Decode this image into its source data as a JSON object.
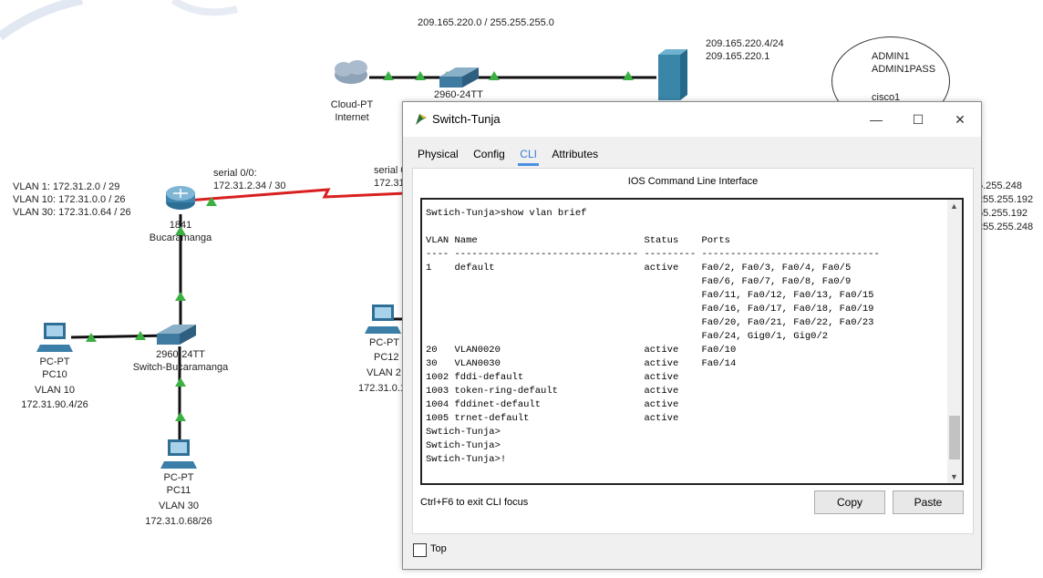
{
  "topology": {
    "network_top": "209.165.220.0 / 255.255.255.0",
    "server_ip": "209.165.220.4/24",
    "server_gw": "209.165.220.1",
    "oval_texts": [
      "ADMIN1",
      "ADMIN1PASS",
      "cisco1"
    ],
    "cloud": {
      "type": "Cloud-PT",
      "name": "Internet"
    },
    "switch_top": "2960-24TT",
    "vlan_list": [
      "VLAN 1: 172.31.2.0 / 29",
      "VLAN 10: 172.31.0.0 / 26",
      "VLAN 30: 172.31.0.64 / 26"
    ],
    "serial_left": {
      "title": "serial 0/0:",
      "ip": "172.31.2.34 / 30"
    },
    "serial_right": {
      "title": "serial 0",
      "ip": "172.31"
    },
    "router": {
      "model": "1841",
      "name": "Bucaramanga"
    },
    "switch_buc": {
      "model": "2960-24TT",
      "name": "Switch-Bucaramanga"
    },
    "pc10": {
      "type": "PC-PT",
      "name": "PC10",
      "vlan": "VLAN 10",
      "ip": "172.31.90.4/26"
    },
    "pc11": {
      "type": "PC-PT",
      "name": "PC11",
      "vlan": "VLAN 30",
      "ip": "172.31.0.68/26"
    },
    "pc12": {
      "type": "PC-PT",
      "name": "PC12",
      "vlan": "VLAN 2",
      "ip": "172.31.0.1"
    },
    "right_masks": [
      "5.255.248",
      "255.255.192",
      "55.255.192",
      "255.255.248"
    ]
  },
  "window": {
    "title": "Switch-Tunja",
    "minimize": "—",
    "maximize": "☐",
    "close": "✕",
    "tabs": [
      "Physical",
      "Config",
      "CLI",
      "Attributes"
    ],
    "active_tab": "CLI",
    "panel_title": "IOS Command Line Interface",
    "terminal_lines": [
      "Swtich-Tunja>show vlan brief",
      "",
      "VLAN Name                             Status    Ports",
      "---- -------------------------------- --------- -------------------------------",
      "1    default                          active    Fa0/2, Fa0/3, Fa0/4, Fa0/5",
      "                                                Fa0/6, Fa0/7, Fa0/8, Fa0/9",
      "                                                Fa0/11, Fa0/12, Fa0/13, Fa0/15",
      "                                                Fa0/16, Fa0/17, Fa0/18, Fa0/19",
      "                                                Fa0/20, Fa0/21, Fa0/22, Fa0/23",
      "                                                Fa0/24, Gig0/1, Gig0/2",
      "20   VLAN0020                         active    Fa0/10",
      "30   VLAN0030                         active    Fa0/14",
      "1002 fddi-default                     active",
      "1003 token-ring-default               active",
      "1004 fddinet-default                  active",
      "1005 trnet-default                    active",
      "Swtich-Tunja>",
      "Swtich-Tunja>",
      "Swtich-Tunja>!"
    ],
    "hint": "Ctrl+F6 to exit CLI focus",
    "copy_label": "Copy",
    "paste_label": "Paste",
    "top_label": "Top",
    "colors": {
      "accent": "#4a90e2",
      "serial_link": "#d92020",
      "link_up": "#3cb043"
    }
  }
}
